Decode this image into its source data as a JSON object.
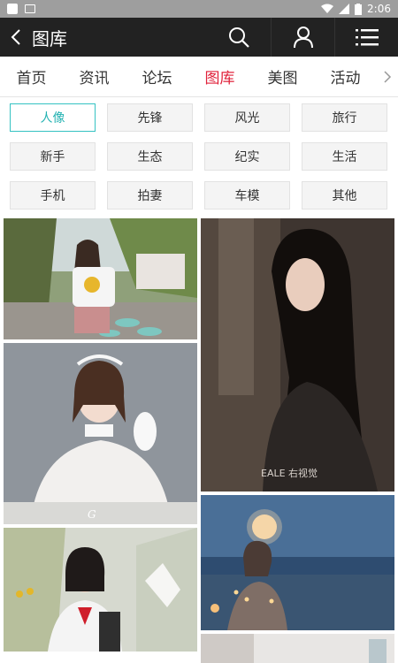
{
  "status_bar": {
    "time": "2:06"
  },
  "app_bar": {
    "title": "图库"
  },
  "tabs": [
    {
      "label": "首页"
    },
    {
      "label": "资讯"
    },
    {
      "label": "论坛"
    },
    {
      "label": "图库"
    },
    {
      "label": "美图"
    },
    {
      "label": "活动"
    }
  ],
  "categories": [
    {
      "label": "人像"
    },
    {
      "label": "先锋"
    },
    {
      "label": "风光"
    },
    {
      "label": "旅行"
    },
    {
      "label": "新手"
    },
    {
      "label": "生态"
    },
    {
      "label": "纪实"
    },
    {
      "label": "生活"
    },
    {
      "label": "手机"
    },
    {
      "label": "拍妻"
    },
    {
      "label": "车模"
    },
    {
      "label": "其他"
    }
  ],
  "photos": {
    "watermark_right": "EALE 右视觉"
  },
  "colors": {
    "active_tab": "#e0213a",
    "active_category": "#23b2b2",
    "app_bar": "#222222"
  }
}
